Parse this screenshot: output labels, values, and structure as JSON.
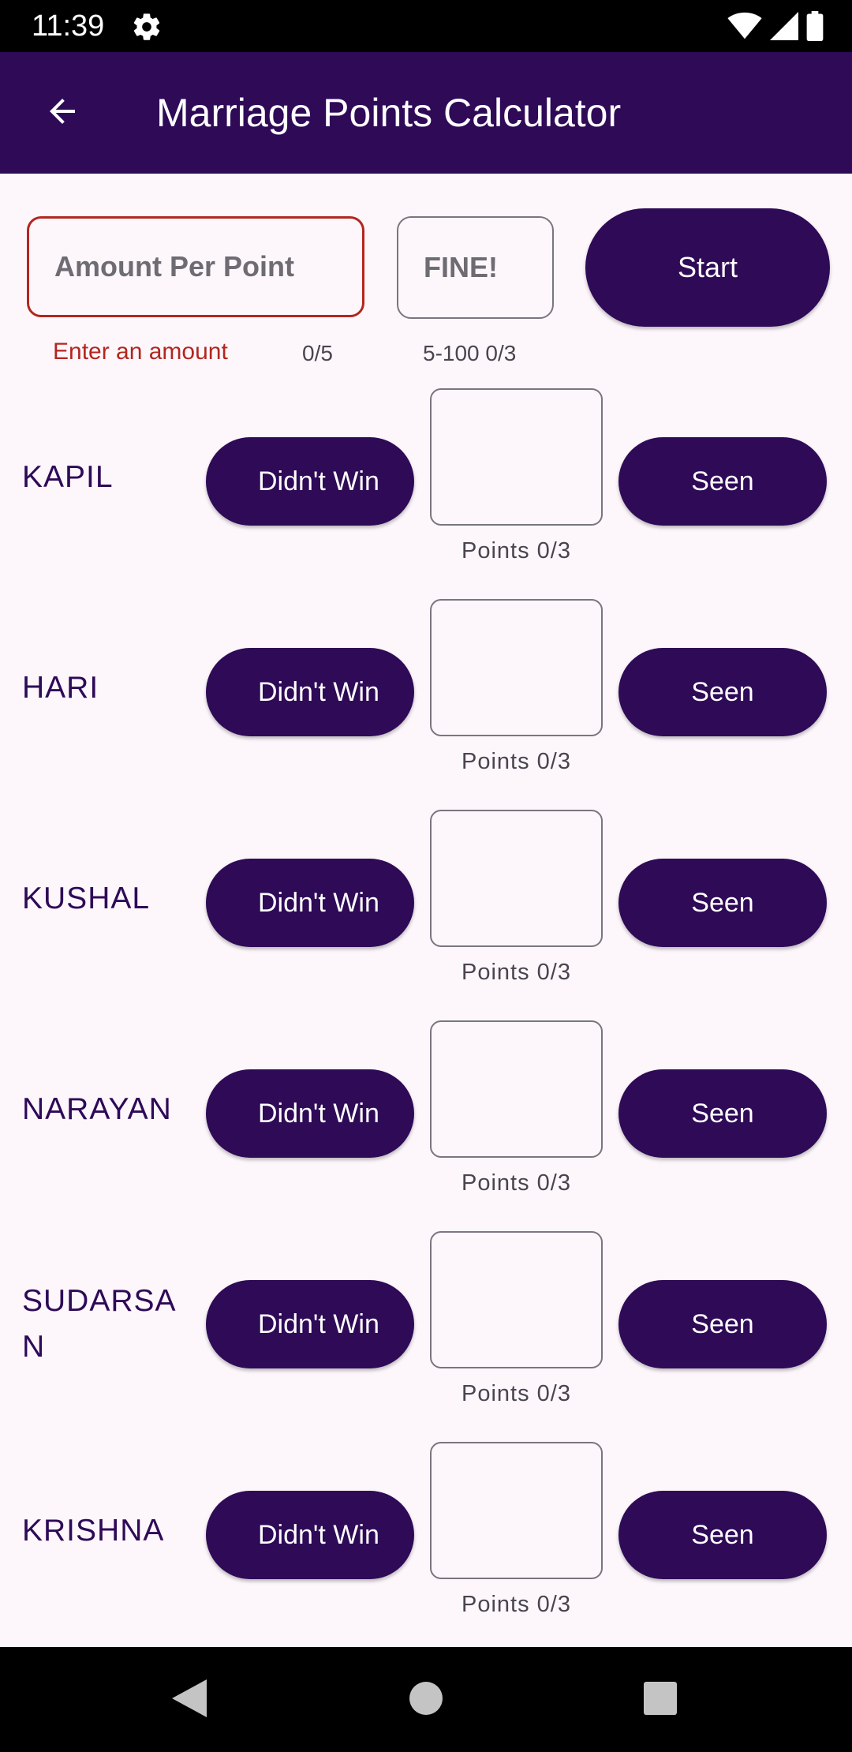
{
  "status_bar": {
    "time": "11:39",
    "icons": [
      "gear-icon",
      "wifi-icon",
      "signal-icon",
      "battery-icon"
    ]
  },
  "app_bar": {
    "title": "Marriage Points Calculator",
    "back_icon": "arrow-left-icon"
  },
  "form": {
    "amount_placeholder": "Amount Per Point",
    "amount_error": "Enter an amount",
    "amount_counter": "0/5",
    "fine_placeholder": "FINE!",
    "fine_helper": "5-100 0/3",
    "start_label": "Start"
  },
  "players": [
    {
      "name": "KAPIL",
      "didnt_win": "Didn't Win",
      "seen": "Seen",
      "points_label": "Points 0/3"
    },
    {
      "name": "HARI",
      "didnt_win": "Didn't Win",
      "seen": "Seen",
      "points_label": "Points 0/3"
    },
    {
      "name": "KUSHAL",
      "didnt_win": "Didn't Win",
      "seen": "Seen",
      "points_label": "Points 0/3"
    },
    {
      "name": "NARAYAN",
      "didnt_win": "Didn't Win",
      "seen": "Seen",
      "points_label": "Points 0/3"
    },
    {
      "name": "SUDARSAN",
      "didnt_win": "Didn't Win",
      "seen": "Seen",
      "points_label": "Points 0/3"
    },
    {
      "name": "KRISHNA",
      "didnt_win": "Didn't Win",
      "seen": "Seen",
      "points_label": "Points 0/3"
    }
  ],
  "nav_bar": {
    "icons": [
      "back-triangle-icon",
      "home-circle-icon",
      "recents-square-icon"
    ]
  },
  "colors": {
    "primary": "#2e0a57",
    "error": "#b3261e",
    "background": "#fdf7fc"
  }
}
